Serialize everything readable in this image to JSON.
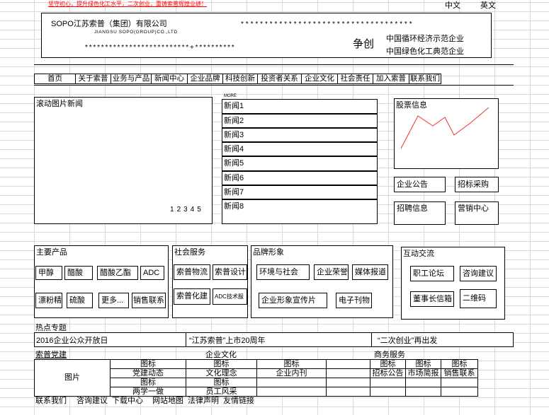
{
  "colors": {
    "slogan": "#ff0000",
    "stock_line": "#f03030",
    "gridline": "#d9d9d9"
  },
  "top_bar": {
    "slogan": "坚守初心，提升绿色化工水平，二次创业，重铸索普辉煌业绩！",
    "lang_zh": "中文",
    "lang_en": "英文"
  },
  "header": {
    "company_name": "SOPO江苏索普（集团）有限公司",
    "company_name_en": "JIANGSU SOPO(GROUP)CO.,LTD",
    "placeholder_1": "************************************",
    "placeholder_2": "**************************+**********",
    "strive": "争创",
    "honors": [
      "中国循环经济示范企业",
      "中国绿色化工典范企业"
    ]
  },
  "nav": {
    "items": [
      "首页",
      "关于索普",
      "业务与产品",
      "新闻中心",
      "企业品牌",
      "科技创新",
      "投资者关系",
      "企业文化",
      "社会责任",
      "加入索普",
      "联系我们"
    ]
  },
  "slideshow": {
    "title": "滚动图片新闻",
    "pages": [
      "1",
      "2",
      "3",
      "4",
      "5"
    ]
  },
  "news": {
    "more": "MORE",
    "items": [
      "新闻1",
      "新闻2",
      "新闻3",
      "新闻4",
      "新闻5",
      "新闻6",
      "新闻7",
      "新闻8"
    ]
  },
  "stock": {
    "title": "股票信息",
    "chart_icon": "line-chart-icon"
  },
  "quick_links": [
    "企业公告",
    "招标采购",
    "招聘信息",
    "营销中心"
  ],
  "products": {
    "title": "主要产品",
    "items": [
      "甲醇",
      "醋酸",
      "醋酸乙酯",
      "ADC",
      "漂粉精",
      "硫酸",
      "更多...",
      "销售联系"
    ]
  },
  "services": {
    "title": "社会服务",
    "items": [
      "索普物流",
      "索普设计",
      "索普化建",
      "ADC技术服"
    ]
  },
  "brand": {
    "title": "品牌形象",
    "items": [
      "环境与社会",
      "企业荣誉",
      "媒体报道",
      "企业形象宣传片",
      "电子刊物"
    ]
  },
  "interaction": {
    "title": "互动交流",
    "items": [
      "职工论坛",
      "咨询建议",
      "董事长信箱",
      "二维码"
    ]
  },
  "hot_topics": {
    "title": "热点专题",
    "items": [
      "2016企业公众开放日",
      "“江苏索普”上市20周年",
      "“二次创业”再出发"
    ]
  },
  "placeholders": {
    "icon": "图标",
    "picture": "图片"
  },
  "columns": {
    "party": {
      "title": "索普党建",
      "links": [
        "党建动态",
        "两学一做"
      ]
    },
    "culture": {
      "title": "企业文化",
      "links": [
        "文化理念",
        "企业内刊",
        "员工风采"
      ]
    },
    "business": {
      "title": "商务服务",
      "links": [
        "招标公告",
        "市场简报",
        "销售联系"
      ]
    }
  },
  "footer": {
    "links": [
      "联系我们",
      "咨询建议",
      "下载中心",
      "网站地图",
      "法律声明",
      "友情链接"
    ]
  }
}
